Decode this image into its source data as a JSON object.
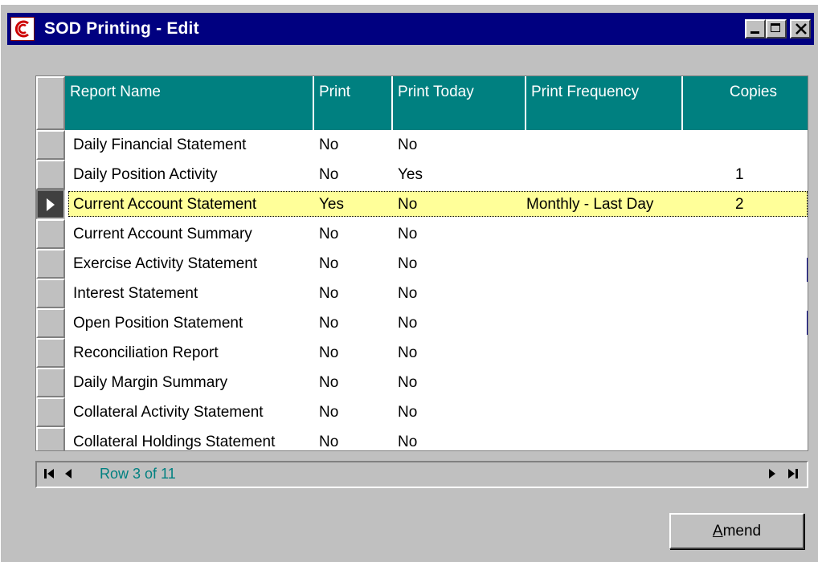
{
  "window": {
    "title": "SOD Printing - Edit",
    "icon": "app-logo-icon"
  },
  "grid": {
    "columns": [
      "Report Name",
      "Print",
      "Print Today",
      "Print Frequency",
      "Copies"
    ],
    "rows": [
      {
        "name": "Daily Financial Statement",
        "print": "No",
        "print_today": "No",
        "frequency": "",
        "copies": ""
      },
      {
        "name": "Daily Position Activity",
        "print": "No",
        "print_today": "Yes",
        "frequency": "",
        "copies": "1"
      },
      {
        "name": "Current Account Statement",
        "print": "Yes",
        "print_today": "No",
        "frequency": "Monthly - Last Day",
        "copies": "2"
      },
      {
        "name": "Current Account Summary",
        "print": "No",
        "print_today": "No",
        "frequency": "",
        "copies": ""
      },
      {
        "name": "Exercise Activity Statement",
        "print": "No",
        "print_today": "No",
        "frequency": "",
        "copies": ""
      },
      {
        "name": "Interest Statement",
        "print": "No",
        "print_today": "No",
        "frequency": "",
        "copies": ""
      },
      {
        "name": "Open Position Statement",
        "print": "No",
        "print_today": "No",
        "frequency": "",
        "copies": ""
      },
      {
        "name": "Reconciliation Report",
        "print": "No",
        "print_today": "No",
        "frequency": "",
        "copies": ""
      },
      {
        "name": "Daily Margin Summary",
        "print": "No",
        "print_today": "No",
        "frequency": "",
        "copies": ""
      },
      {
        "name": "Collateral Activity Statement",
        "print": "No",
        "print_today": "No",
        "frequency": "",
        "copies": ""
      },
      {
        "name": "Collateral Holdings Statement",
        "print": "No",
        "print_today": "No",
        "frequency": "",
        "copies": ""
      }
    ],
    "selected_row": 3
  },
  "navigator": {
    "status": "Row 3 of 11"
  },
  "buttons": {
    "amend_label_underlined": "A",
    "amend_label_rest": "mend"
  },
  "colors": {
    "titlebar": "#000080",
    "header": "#008080",
    "selected_row": "#ffff99",
    "face": "#c0c0c0"
  }
}
